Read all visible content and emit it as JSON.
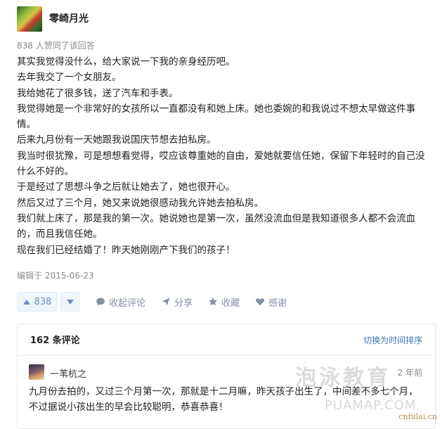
{
  "answer": {
    "author": "零崎月光",
    "votes_line": "838 人赞同了该回答",
    "paragraphs": [
      "其实我觉得没什么，给大家说一下我的亲身经历吧。",
      "去年我交了一个女朋友。",
      "我给她花了很多钱，送了汽车和手表。",
      "我觉得她是一个非常好的女孩所以一直都没有和她上床。她也委婉的和我说过不想太早做这件事情。",
      "后来九月份有一天她跟我说国庆节想去拍私房。",
      "我当时很犹豫，可是想想看觉得，哎应该尊重她的自由，爱她就要信任她，保留下年轻时的自己没什么不好的。",
      "于是经过了思想斗争之后就让她去了，她也很开心。",
      "然后又过了三个月，她又来说她很感动我允许她去拍私房。",
      "我们就上床了，那是我的第一次。她说她也是第一次，虽然没流血但是我知道很多人都不会流血的，而且我信任她。",
      "现在我们已经结婚了！昨天她刚刚产下我们的孩子！"
    ],
    "edited": "编辑于 2015-06-23"
  },
  "actions": {
    "vote_count": "838",
    "collapse": "收起评论",
    "share": "分享",
    "collect": "收藏",
    "thanks": "感谢"
  },
  "comments": {
    "count": "162 条评论",
    "sort_toggle": "切换为时间排序",
    "items": [
      {
        "author": "一苇杭之",
        "time": "2 年前",
        "text": "九月份去拍的，又过三个月第一次，那就是十二月嘛，昨天孩子出生了，中间差不多七个月，不过据说小孩出生的早会比较聪明，恭喜恭喜！"
      }
    ]
  },
  "watermark": {
    "logo": "泡泳教育",
    "url": "PUAMAP.COM",
    "corner": "cnfulai.cn"
  },
  "colors": {
    "accent": "#698ebf",
    "link": "#3a74b8",
    "muted": "#8a8a8a"
  }
}
